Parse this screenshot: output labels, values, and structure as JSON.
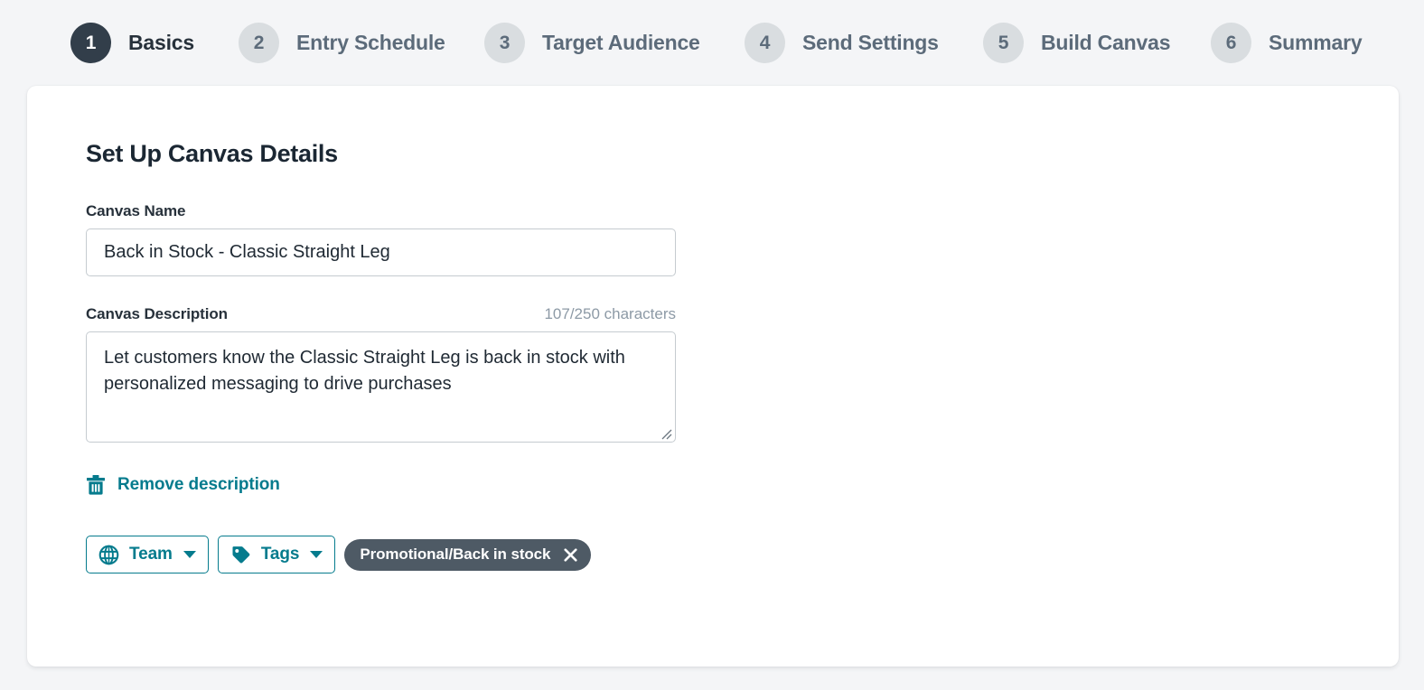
{
  "stepper": {
    "steps": [
      {
        "number": "1",
        "label": "Basics",
        "state": "active"
      },
      {
        "number": "2",
        "label": "Entry Schedule",
        "state": "inactive"
      },
      {
        "number": "3",
        "label": "Target Audience",
        "state": "inactive"
      },
      {
        "number": "4",
        "label": "Send Settings",
        "state": "inactive"
      },
      {
        "number": "5",
        "label": "Build Canvas",
        "state": "inactive"
      },
      {
        "number": "6",
        "label": "Summary",
        "state": "inactive"
      }
    ]
  },
  "card": {
    "title": "Set Up Canvas Details",
    "canvas_name": {
      "label": "Canvas Name",
      "value": "Back in Stock - Classic Straight Leg",
      "placeholder": "Canvas Name"
    },
    "canvas_description": {
      "label": "Canvas Description",
      "char_count": "107/250 characters",
      "value": "Let customers know the Classic Straight Leg is back in stock with personalized messaging to drive purchases",
      "placeholder": "Canvas Description"
    },
    "remove_description": {
      "label": "Remove description",
      "icon": "trash-icon"
    },
    "controls": {
      "team": {
        "label": "Team",
        "icon": "globe-icon",
        "caret": "chevron-down-icon"
      },
      "tags": {
        "label": "Tags",
        "icon": "tag-icon",
        "caret": "chevron-down-icon"
      },
      "chips": [
        {
          "label": "Promotional/Back in stock",
          "close_icon": "close-icon"
        }
      ]
    }
  },
  "colors": {
    "page_background": "#f4f5f7",
    "card_background": "#ffffff",
    "active_step": "#323e4a",
    "inactive_step": "#d9dde0",
    "accent_teal": "#057b8d",
    "chip_background": "#4e5a65",
    "muted_text": "#8d9aa6",
    "input_border": "#c5cbd0"
  }
}
